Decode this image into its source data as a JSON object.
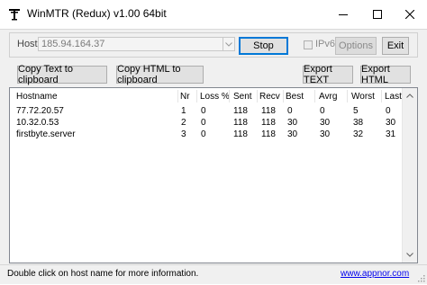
{
  "window": {
    "title": "WinMTR (Redux) v1.00 64bit"
  },
  "icons": {
    "app": "tower-antenna-icon",
    "minimize": "minimize-icon",
    "maximize": "maximize-icon",
    "close": "close-icon",
    "dropdown": "chevron-down-icon",
    "scroll_up": "scroll-up-icon",
    "scroll_down": "scroll-down-icon",
    "grip": "resize-grip-icon"
  },
  "host": {
    "label": "Host:",
    "value": "185.94.164.37"
  },
  "buttons": {
    "stop": "Stop",
    "ipv6": "IPv6",
    "options": "Options",
    "exit": "Exit",
    "copy_text": "Copy Text to clipboard",
    "copy_html": "Copy HTML to clipboard",
    "export_text": "Export TEXT",
    "export_html": "Export HTML"
  },
  "table": {
    "columns": [
      "Hostname",
      "Nr",
      "Loss %",
      "Sent",
      "Recv",
      "Best",
      "Avrg",
      "Worst",
      "Last"
    ],
    "rows": [
      [
        "77.72.20.57",
        "1",
        "0",
        "118",
        "118",
        "0",
        "0",
        "5",
        "0"
      ],
      [
        "10.32.0.53",
        "2",
        "0",
        "118",
        "118",
        "30",
        "30",
        "38",
        "30"
      ],
      [
        "firstbyte.server",
        "3",
        "0",
        "118",
        "118",
        "30",
        "30",
        "32",
        "31"
      ]
    ]
  },
  "status": {
    "text": "Double click on host name for more information.",
    "link": "www.appnor.com"
  },
  "colors": {
    "link": "#0000ee",
    "default_button_border": "#0078d7"
  }
}
